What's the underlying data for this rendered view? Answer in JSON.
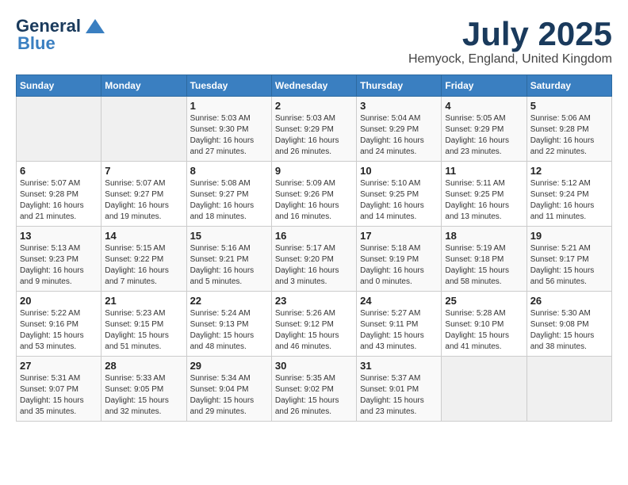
{
  "logo": {
    "general": "General",
    "blue": "Blue"
  },
  "title": {
    "month": "July 2025",
    "location": "Hemyock, England, United Kingdom"
  },
  "weekdays": [
    "Sunday",
    "Monday",
    "Tuesday",
    "Wednesday",
    "Thursday",
    "Friday",
    "Saturday"
  ],
  "weeks": [
    [
      {
        "day": "",
        "info": ""
      },
      {
        "day": "",
        "info": ""
      },
      {
        "day": "1",
        "info": "Sunrise: 5:03 AM\nSunset: 9:30 PM\nDaylight: 16 hours and 27 minutes."
      },
      {
        "day": "2",
        "info": "Sunrise: 5:03 AM\nSunset: 9:29 PM\nDaylight: 16 hours and 26 minutes."
      },
      {
        "day": "3",
        "info": "Sunrise: 5:04 AM\nSunset: 9:29 PM\nDaylight: 16 hours and 24 minutes."
      },
      {
        "day": "4",
        "info": "Sunrise: 5:05 AM\nSunset: 9:29 PM\nDaylight: 16 hours and 23 minutes."
      },
      {
        "day": "5",
        "info": "Sunrise: 5:06 AM\nSunset: 9:28 PM\nDaylight: 16 hours and 22 minutes."
      }
    ],
    [
      {
        "day": "6",
        "info": "Sunrise: 5:07 AM\nSunset: 9:28 PM\nDaylight: 16 hours and 21 minutes."
      },
      {
        "day": "7",
        "info": "Sunrise: 5:07 AM\nSunset: 9:27 PM\nDaylight: 16 hours and 19 minutes."
      },
      {
        "day": "8",
        "info": "Sunrise: 5:08 AM\nSunset: 9:27 PM\nDaylight: 16 hours and 18 minutes."
      },
      {
        "day": "9",
        "info": "Sunrise: 5:09 AM\nSunset: 9:26 PM\nDaylight: 16 hours and 16 minutes."
      },
      {
        "day": "10",
        "info": "Sunrise: 5:10 AM\nSunset: 9:25 PM\nDaylight: 16 hours and 14 minutes."
      },
      {
        "day": "11",
        "info": "Sunrise: 5:11 AM\nSunset: 9:25 PM\nDaylight: 16 hours and 13 minutes."
      },
      {
        "day": "12",
        "info": "Sunrise: 5:12 AM\nSunset: 9:24 PM\nDaylight: 16 hours and 11 minutes."
      }
    ],
    [
      {
        "day": "13",
        "info": "Sunrise: 5:13 AM\nSunset: 9:23 PM\nDaylight: 16 hours and 9 minutes."
      },
      {
        "day": "14",
        "info": "Sunrise: 5:15 AM\nSunset: 9:22 PM\nDaylight: 16 hours and 7 minutes."
      },
      {
        "day": "15",
        "info": "Sunrise: 5:16 AM\nSunset: 9:21 PM\nDaylight: 16 hours and 5 minutes."
      },
      {
        "day": "16",
        "info": "Sunrise: 5:17 AM\nSunset: 9:20 PM\nDaylight: 16 hours and 3 minutes."
      },
      {
        "day": "17",
        "info": "Sunrise: 5:18 AM\nSunset: 9:19 PM\nDaylight: 16 hours and 0 minutes."
      },
      {
        "day": "18",
        "info": "Sunrise: 5:19 AM\nSunset: 9:18 PM\nDaylight: 15 hours and 58 minutes."
      },
      {
        "day": "19",
        "info": "Sunrise: 5:21 AM\nSunset: 9:17 PM\nDaylight: 15 hours and 56 minutes."
      }
    ],
    [
      {
        "day": "20",
        "info": "Sunrise: 5:22 AM\nSunset: 9:16 PM\nDaylight: 15 hours and 53 minutes."
      },
      {
        "day": "21",
        "info": "Sunrise: 5:23 AM\nSunset: 9:15 PM\nDaylight: 15 hours and 51 minutes."
      },
      {
        "day": "22",
        "info": "Sunrise: 5:24 AM\nSunset: 9:13 PM\nDaylight: 15 hours and 48 minutes."
      },
      {
        "day": "23",
        "info": "Sunrise: 5:26 AM\nSunset: 9:12 PM\nDaylight: 15 hours and 46 minutes."
      },
      {
        "day": "24",
        "info": "Sunrise: 5:27 AM\nSunset: 9:11 PM\nDaylight: 15 hours and 43 minutes."
      },
      {
        "day": "25",
        "info": "Sunrise: 5:28 AM\nSunset: 9:10 PM\nDaylight: 15 hours and 41 minutes."
      },
      {
        "day": "26",
        "info": "Sunrise: 5:30 AM\nSunset: 9:08 PM\nDaylight: 15 hours and 38 minutes."
      }
    ],
    [
      {
        "day": "27",
        "info": "Sunrise: 5:31 AM\nSunset: 9:07 PM\nDaylight: 15 hours and 35 minutes."
      },
      {
        "day": "28",
        "info": "Sunrise: 5:33 AM\nSunset: 9:05 PM\nDaylight: 15 hours and 32 minutes."
      },
      {
        "day": "29",
        "info": "Sunrise: 5:34 AM\nSunset: 9:04 PM\nDaylight: 15 hours and 29 minutes."
      },
      {
        "day": "30",
        "info": "Sunrise: 5:35 AM\nSunset: 9:02 PM\nDaylight: 15 hours and 26 minutes."
      },
      {
        "day": "31",
        "info": "Sunrise: 5:37 AM\nSunset: 9:01 PM\nDaylight: 15 hours and 23 minutes."
      },
      {
        "day": "",
        "info": ""
      },
      {
        "day": "",
        "info": ""
      }
    ]
  ]
}
